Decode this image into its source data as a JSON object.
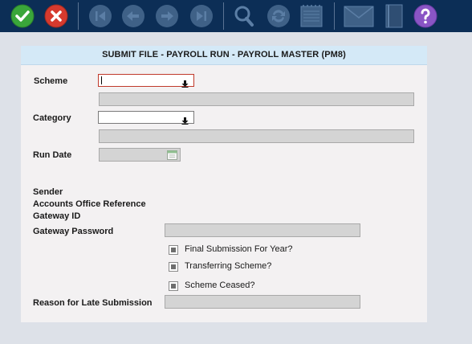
{
  "window": {
    "title": "SUBMIT FILE - PAYROLL RUN - PAYROLL MASTER (PM8)"
  },
  "toolbar": {
    "icons": [
      "check-icon",
      "cancel-icon",
      "first-record-icon",
      "previous-record-icon",
      "next-record-icon",
      "last-record-icon",
      "search-icon",
      "refresh-icon",
      "notepad-icon",
      "mail-icon",
      "book-icon",
      "help-icon"
    ],
    "colors": {
      "bar": "#0c2e56",
      "ok": "#3aa63a",
      "cancel": "#d63a2e",
      "help": "#8a55c5",
      "disabled": "#3f6187"
    }
  },
  "form": {
    "scheme_label": "Scheme",
    "scheme_value": "",
    "category_label": "Category",
    "category_value": "",
    "run_date_label": "Run Date",
    "run_date_value": "",
    "sender_label": "Sender",
    "accounts_office_ref_label": "Accounts Office Reference",
    "gateway_id_label": "Gateway ID",
    "gateway_password_label": "Gateway Password",
    "final_submission_label": "Final Submission For Year?",
    "transferring_scheme_label": "Transferring Scheme?",
    "scheme_ceased_label": "Scheme Ceased?",
    "late_submission_label": "Reason for Late Submission"
  }
}
